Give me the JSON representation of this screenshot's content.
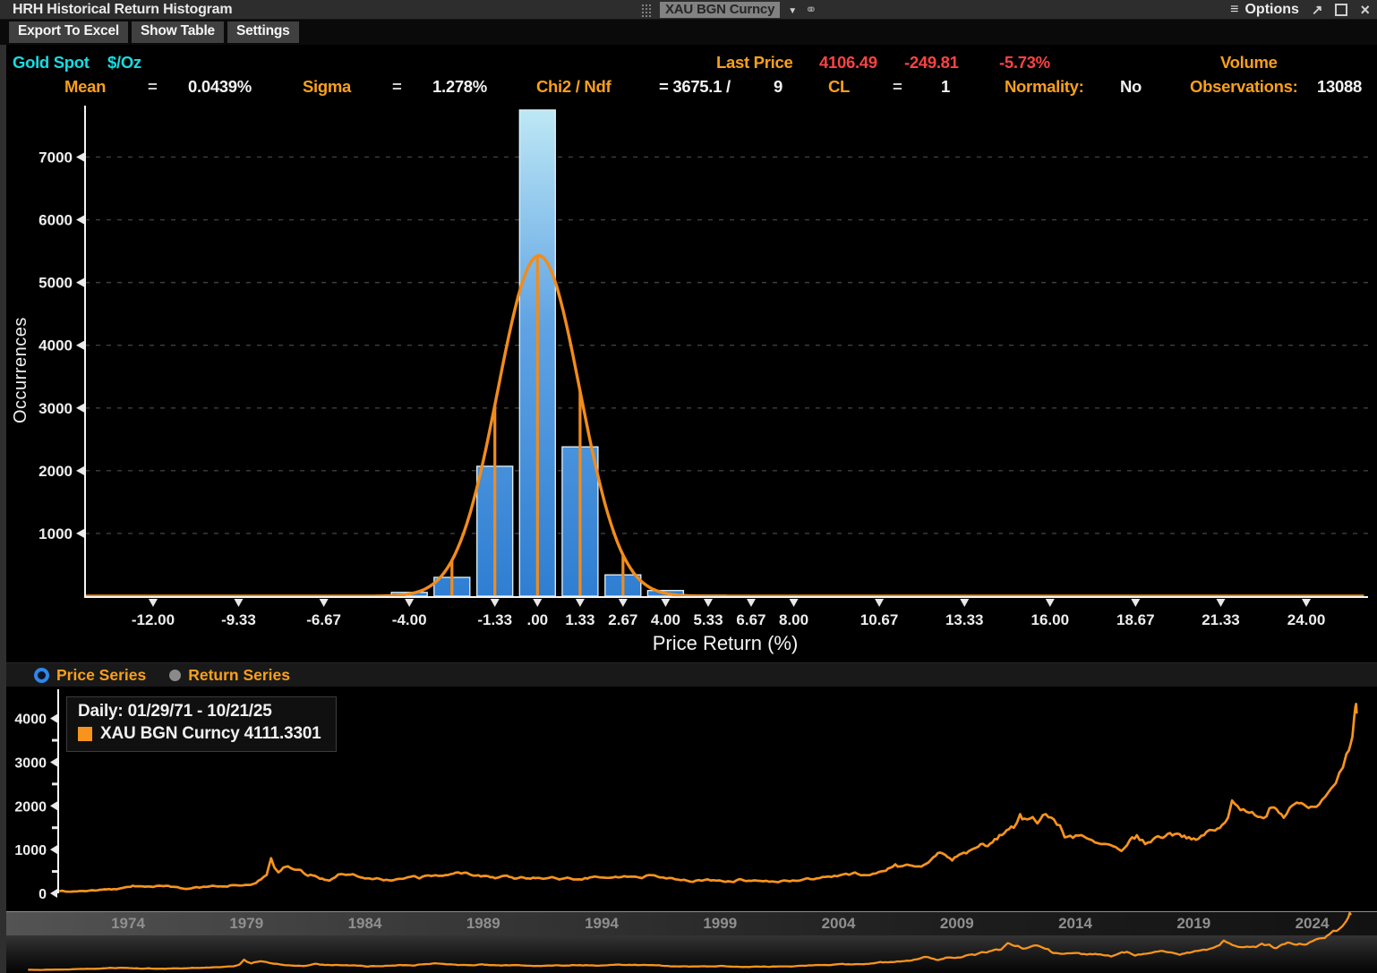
{
  "window": {
    "title": "HRH Historical Return Histogram",
    "ticker": "XAU BGN Curncy",
    "options_label": "Options",
    "icons": {
      "hamburger": "≡",
      "dropdown": "▼",
      "link": "⚭",
      "expand": "↗",
      "close": "×"
    }
  },
  "toolbar": {
    "buttons": [
      "Export To Excel",
      "Show Table",
      "Settings"
    ]
  },
  "stats": {
    "instrument": "Gold Spot",
    "unit": "$/Oz",
    "last_price_label": "Last Price",
    "last_price": "4106.49",
    "change": "-249.81",
    "pct_change": "-5.73%",
    "volume_label": "Volume",
    "mean_label": "Mean",
    "mean_eq": "=",
    "mean_value": "0.0439%",
    "sigma_label": "Sigma",
    "sigma_eq": "=",
    "sigma_value": "1.278%",
    "chi2_label": "Chi2 / Ndf",
    "chi2_value": "= 3675.1 /",
    "ndf_value": "9",
    "cl_label": "CL",
    "cl_eq": "=",
    "cl_value": "1",
    "normality_label": "Normality:",
    "normality_value": "No",
    "observations_label": "Observations:",
    "observations_value": "13088"
  },
  "radio_row": {
    "options": [
      {
        "label": "Price Series",
        "selected": true
      },
      {
        "label": "Return Series",
        "selected": false
      }
    ]
  },
  "chart_data": [
    {
      "type": "bar",
      "name": "historical-return-histogram",
      "ylabel": "Occurrences",
      "xlabel": "Price Return (%)",
      "bin_width_pct": 1.333,
      "bins": [
        {
          "center": -5.33,
          "count": 12
        },
        {
          "center": -4.0,
          "count": 60
        },
        {
          "center": -2.67,
          "count": 300
        },
        {
          "center": -1.33,
          "count": 2070
        },
        {
          "center": 0.0,
          "count": 7750
        },
        {
          "center": 1.33,
          "count": 2380
        },
        {
          "center": 2.67,
          "count": 340
        },
        {
          "center": 4.0,
          "count": 90
        },
        {
          "center": 5.33,
          "count": 15
        }
      ],
      "fit": {
        "type": "gaussian",
        "mean": 0.0439,
        "sigma": 1.278,
        "peak_occurrences": 5430
      },
      "x_ticks": [
        -12,
        -9.33,
        -6.67,
        -4,
        -1.33,
        0,
        1.33,
        2.67,
        4,
        5.33,
        6.67,
        8,
        10.67,
        13.33,
        16,
        18.67,
        21.33,
        24
      ],
      "x_tick_labels": [
        "-12.00",
        "-9.33",
        "-6.67",
        "-4.00",
        "-1.33",
        ".00",
        "1.33",
        "2.67",
        "4.00",
        "5.33",
        "6.67",
        "8.00",
        "10.67",
        "13.33",
        "16.00",
        "18.67",
        "21.33",
        "24.00"
      ],
      "y_ticks": [
        1000,
        2000,
        3000,
        4000,
        5000,
        6000,
        7000
      ],
      "xlim": [
        -14.1,
        25.9
      ],
      "ylim": [
        0,
        7820
      ],
      "grid": true,
      "bar_color_top": "#bfe9f5",
      "bar_color_mid": "#5fa3e4",
      "bar_color_bottom": "#2f7ed2",
      "bar_stroke": "#e4f4fb",
      "fit_color": "#f28c1a"
    },
    {
      "type": "line",
      "name": "price-series",
      "legend": {
        "line1": "Daily: 01/29/71 - 10/21/25",
        "line2": "XAU BGN Curncy 4111.3301",
        "swatch_color": "#f7941d"
      },
      "x_ticks": [
        1974,
        1979,
        1984,
        1989,
        1994,
        1999,
        2004,
        2009,
        2014,
        2019,
        2024
      ],
      "y_ticks": [
        0,
        1000,
        2000,
        3000,
        4000
      ],
      "xlim": [
        1971.05,
        2025.95
      ],
      "ylim": [
        0,
        4700
      ],
      "line_color": "#f7941d",
      "points": [
        [
          1971.1,
          38
        ],
        [
          1971.6,
          41
        ],
        [
          1972.1,
          49
        ],
        [
          1972.6,
          62
        ],
        [
          1973.0,
          78
        ],
        [
          1973.4,
          95
        ],
        [
          1973.8,
          108
        ],
        [
          1974.2,
          158
        ],
        [
          1974.6,
          172
        ],
        [
          1974.95,
          185
        ],
        [
          1975.3,
          168
        ],
        [
          1975.7,
          143
        ],
        [
          1976.1,
          131
        ],
        [
          1976.55,
          110
        ],
        [
          1976.9,
          124
        ],
        [
          1977.3,
          140
        ],
        [
          1977.8,
          162
        ],
        [
          1978.2,
          180
        ],
        [
          1978.6,
          205
        ],
        [
          1978.95,
          222
        ],
        [
          1979.3,
          255
        ],
        [
          1979.6,
          320
        ],
        [
          1979.85,
          430
        ],
        [
          1980.04,
          835
        ],
        [
          1980.18,
          640
        ],
        [
          1980.35,
          515
        ],
        [
          1980.55,
          620
        ],
        [
          1980.75,
          660
        ],
        [
          1981.0,
          555
        ],
        [
          1981.3,
          480
        ],
        [
          1981.6,
          415
        ],
        [
          1981.9,
          400
        ],
        [
          1982.2,
          350
        ],
        [
          1982.5,
          325
        ],
        [
          1982.75,
          410
        ],
        [
          1983.0,
          480
        ],
        [
          1983.3,
          425
        ],
        [
          1983.6,
          415
        ],
        [
          1983.9,
          385
        ],
        [
          1984.3,
          375
        ],
        [
          1984.7,
          340
        ],
        [
          1985.1,
          300
        ],
        [
          1985.5,
          315
        ],
        [
          1985.9,
          330
        ],
        [
          1986.3,
          345
        ],
        [
          1986.7,
          390
        ],
        [
          1987.1,
          405
        ],
        [
          1987.5,
          450
        ],
        [
          1987.95,
          480
        ],
        [
          1988.3,
          450
        ],
        [
          1988.7,
          425
        ],
        [
          1989.1,
          395
        ],
        [
          1989.5,
          370
        ],
        [
          1989.9,
          405
        ],
        [
          1990.3,
          372
        ],
        [
          1990.6,
          390
        ],
        [
          1991.0,
          365
        ],
        [
          1991.4,
          355
        ],
        [
          1991.9,
          352
        ],
        [
          1992.3,
          340
        ],
        [
          1992.8,
          333
        ],
        [
          1993.3,
          372
        ],
        [
          1993.7,
          390
        ],
        [
          1994.2,
          382
        ],
        [
          1994.7,
          386
        ],
        [
          1995.2,
          384
        ],
        [
          1995.7,
          387
        ],
        [
          1996.1,
          402
        ],
        [
          1996.6,
          383
        ],
        [
          1997.1,
          348
        ],
        [
          1997.6,
          320
        ],
        [
          1998.1,
          295
        ],
        [
          1998.6,
          292
        ],
        [
          1999.1,
          282
        ],
        [
          1999.45,
          258
        ],
        [
          1999.8,
          300
        ],
        [
          2000.2,
          282
        ],
        [
          2000.7,
          272
        ],
        [
          2001.2,
          262
        ],
        [
          2001.7,
          274
        ],
        [
          2002.2,
          302
        ],
        [
          2002.7,
          318
        ],
        [
          2003.2,
          345
        ],
        [
          2003.7,
          378
        ],
        [
          2004.2,
          408
        ],
        [
          2004.7,
          432
        ],
        [
          2005.2,
          428
        ],
        [
          2005.7,
          462
        ],
        [
          2006.0,
          540
        ],
        [
          2006.4,
          625
        ],
        [
          2006.7,
          590
        ],
        [
          2007.1,
          650
        ],
        [
          2007.5,
          672
        ],
        [
          2007.9,
          790
        ],
        [
          2008.2,
          925
        ],
        [
          2008.5,
          880
        ],
        [
          2008.8,
          770
        ],
        [
          2009.1,
          900
        ],
        [
          2009.5,
          950
        ],
        [
          2009.9,
          1090
        ],
        [
          2010.3,
          1120
        ],
        [
          2010.7,
          1300
        ],
        [
          2011.1,
          1420
        ],
        [
          2011.4,
          1510
        ],
        [
          2011.67,
          1880
        ],
        [
          2011.85,
          1740
        ],
        [
          2012.1,
          1680
        ],
        [
          2012.4,
          1610
        ],
        [
          2012.75,
          1740
        ],
        [
          2013.1,
          1660
        ],
        [
          2013.35,
          1560
        ],
        [
          2013.55,
          1310
        ],
        [
          2013.9,
          1250
        ],
        [
          2014.25,
          1300
        ],
        [
          2014.6,
          1290
        ],
        [
          2014.95,
          1195
        ],
        [
          2015.3,
          1180
        ],
        [
          2015.7,
          1130
        ],
        [
          2015.95,
          1065
        ],
        [
          2016.3,
          1240
        ],
        [
          2016.6,
          1330
        ],
        [
          2016.95,
          1140
        ],
        [
          2017.3,
          1250
        ],
        [
          2017.7,
          1280
        ],
        [
          2018.1,
          1330
        ],
        [
          2018.5,
          1260
        ],
        [
          2018.8,
          1210
        ],
        [
          2019.2,
          1300
        ],
        [
          2019.55,
          1420
        ],
        [
          2019.9,
          1480
        ],
        [
          2020.2,
          1590
        ],
        [
          2020.45,
          1720
        ],
        [
          2020.62,
          2040
        ],
        [
          2020.85,
          1900
        ],
        [
          2021.1,
          1850
        ],
        [
          2021.35,
          1730
        ],
        [
          2021.7,
          1800
        ],
        [
          2021.95,
          1790
        ],
        [
          2022.2,
          1950
        ],
        [
          2022.5,
          1850
        ],
        [
          2022.8,
          1660
        ],
        [
          2023.05,
          1830
        ],
        [
          2023.35,
          1985
        ],
        [
          2023.65,
          1920
        ],
        [
          2023.85,
          1985
        ],
        [
          2024.05,
          2040
        ],
        [
          2024.3,
          2160
        ],
        [
          2024.55,
          2330
        ],
        [
          2024.8,
          2520
        ],
        [
          2025.0,
          2640
        ],
        [
          2025.15,
          2880
        ],
        [
          2025.3,
          2990
        ],
        [
          2025.45,
          3230
        ],
        [
          2025.55,
          3370
        ],
        [
          2025.62,
          3440
        ],
        [
          2025.7,
          3680
        ],
        [
          2025.78,
          3980
        ],
        [
          2025.83,
          4250
        ],
        [
          2025.86,
          4345
        ],
        [
          2025.88,
          4111
        ]
      ]
    }
  ]
}
